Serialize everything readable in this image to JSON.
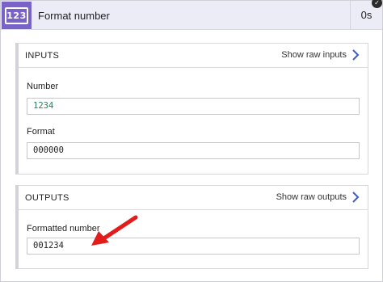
{
  "header": {
    "icon_text": "123",
    "title": "Format number",
    "duration": "0s",
    "status_icon": "check-icon"
  },
  "inputs": {
    "title": "INPUTS",
    "raw_link": "Show raw inputs",
    "fields": [
      {
        "label": "Number",
        "value": "1234"
      },
      {
        "label": "Format",
        "value": "000000"
      }
    ]
  },
  "outputs": {
    "title": "OUTPUTS",
    "raw_link": "Show raw outputs",
    "fields": [
      {
        "label": "Formatted number",
        "value": "001234"
      }
    ]
  },
  "colors": {
    "accent": "#7a63c6",
    "link_chevron": "#3b5bcc",
    "number_value": "#2f7d5b",
    "annotation_arrow": "#e31b1b"
  }
}
